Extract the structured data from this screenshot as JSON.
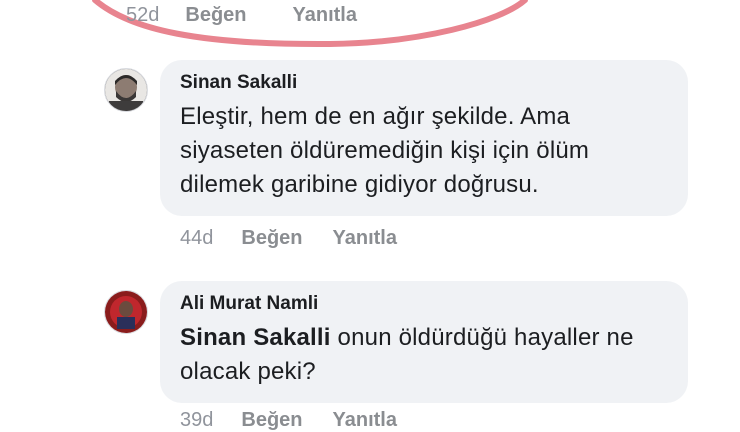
{
  "comments": [
    {
      "time": "52d",
      "like_label": "Beğen",
      "reply_label": "Yanıtla"
    },
    {
      "author": "Sinan Sakalli",
      "text": "Eleştir, hem de en ağır şekilde.  Ama siyaseten öldüremediğin kişi için ölüm dilemek garibine gidiyor doğrusu.",
      "time": "44d",
      "like_label": "Beğen",
      "reply_label": "Yanıtla"
    },
    {
      "author": "Ali Murat Namli",
      "mention": "Sinan Sakalli",
      "text": "onun öldürdüğü hayaller ne olacak peki?",
      "time": "39d",
      "like_label": "Beğen",
      "reply_label": "Yanıtla"
    }
  ],
  "annotation_color": "#e8848f"
}
